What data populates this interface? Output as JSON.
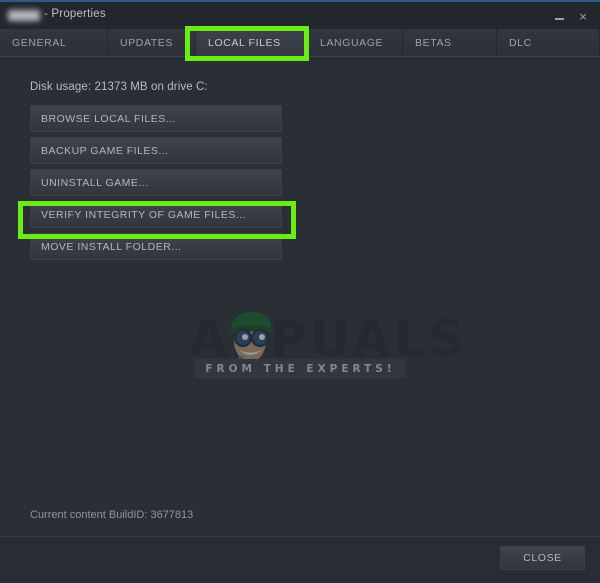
{
  "window": {
    "title_suffix": "- Properties",
    "blurred_game_name": "",
    "minimize_label": "",
    "close_label": "×"
  },
  "tabs": [
    {
      "label": "GENERAL",
      "active": false
    },
    {
      "label": "UPDATES",
      "active": false
    },
    {
      "label": "LOCAL FILES",
      "active": true
    },
    {
      "label": "LANGUAGE",
      "active": false
    },
    {
      "label": "BETAS",
      "active": false
    },
    {
      "label": "DLC",
      "active": false
    }
  ],
  "main": {
    "disk_usage": "Disk usage: 21373 MB on drive C:",
    "buttons": [
      {
        "label": "BROWSE LOCAL FILES..."
      },
      {
        "label": "BACKUP GAME FILES..."
      },
      {
        "label": "UNINSTALL GAME..."
      },
      {
        "label": "VERIFY INTEGRITY OF GAME FILES..."
      },
      {
        "label": "MOVE INSTALL FOLDER..."
      }
    ],
    "build_id": "Current content BuildID: 3677813"
  },
  "watermark": {
    "word": "APPUALS",
    "tagline": "FROM THE EXPERTS!"
  },
  "footer": {
    "close_label": "CLOSE"
  },
  "annotations": {
    "highlight_color": "#68ee15",
    "highlighted_tab": "LOCAL FILES",
    "highlighted_button": "VERIFY INTEGRITY OF GAME FILES..."
  }
}
